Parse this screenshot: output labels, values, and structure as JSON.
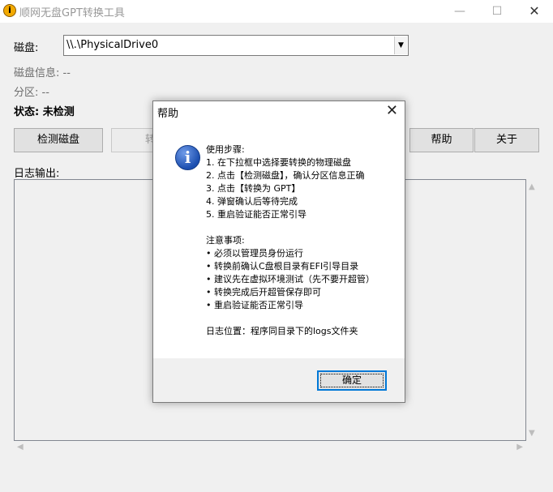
{
  "window": {
    "title": "顺网无盘GPT转换工具",
    "app_icon_glyph": "i",
    "minimize_glyph": "—",
    "maximize_glyph": "☐",
    "close_glyph": "✕"
  },
  "main": {
    "disk_label": "磁盘:",
    "disk_selected": "\\\\.\\PhysicalDrive0",
    "disk_info": "磁盘信息: --",
    "partition": "分区: --",
    "status": "状态: 未检测",
    "buttons": {
      "detect": "检测磁盘",
      "convert": "转换",
      "help": "帮助",
      "about": "关于"
    },
    "log_label": "日志输出:"
  },
  "dialog": {
    "title": "帮助",
    "close_glyph": "✕",
    "lines": [
      "使用步骤:",
      "1. 在下拉框中选择要转换的物理磁盘",
      "2. 点击【检测磁盘】，确认分区信息正确",
      "3. 点击【转换为 GPT】",
      "4. 弹窗确认后等待完成",
      "5. 重启验证能否正常引导",
      "",
      "注意事项:",
      "• 必须以管理员身份运行",
      "• 转换前确认C盘根目录有EFI引导目录",
      "• 建议先在虚拟环境测试（先不要开超管）",
      "• 转换完成后开超管保存即可",
      "• 重启验证能否正常引导",
      "",
      "日志位置：程序同目录下的logs文件夹"
    ],
    "ok_label": "确定"
  },
  "colors": {
    "window_bg": "#f0f0f0",
    "focus_border": "#0078d7",
    "info_icon": "#1c4fb0"
  }
}
